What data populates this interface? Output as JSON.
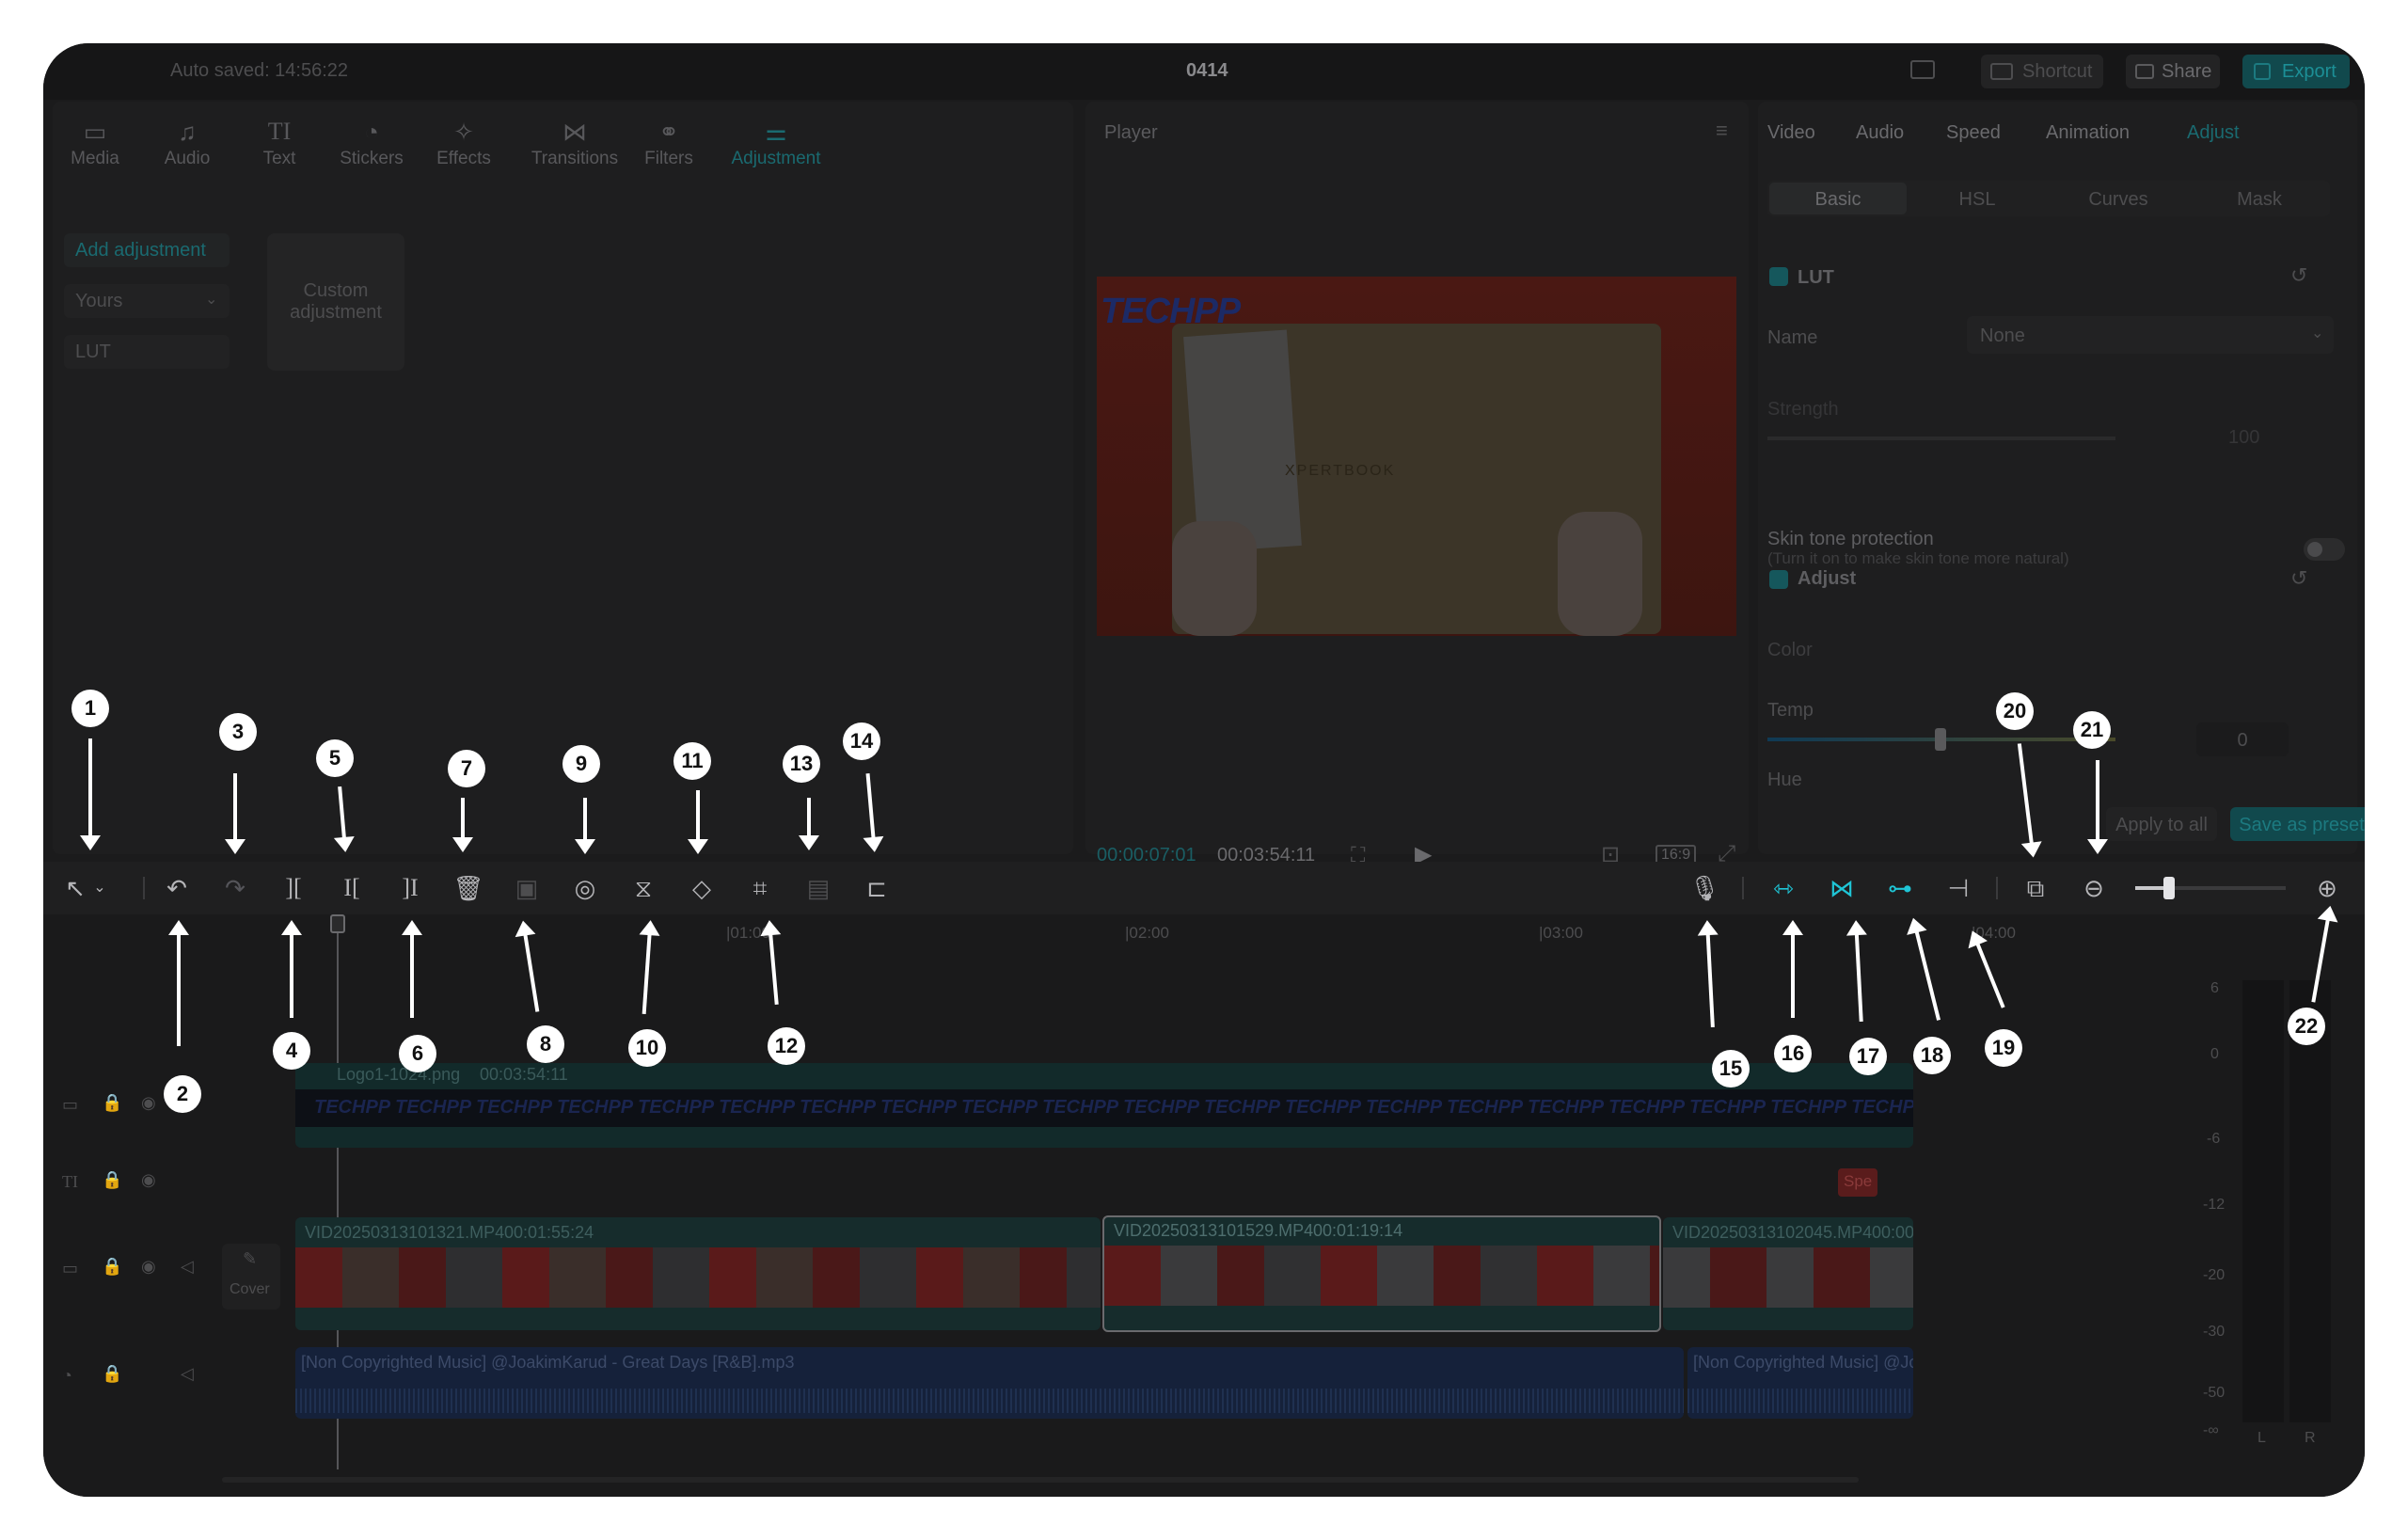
{
  "titlebar": {
    "autosave": "Auto saved: 14:56:22",
    "project": "0414",
    "shortcut": "Shortcut",
    "share": "Share",
    "export": "Export"
  },
  "left": {
    "tabs": [
      {
        "label": "Media",
        "icon": "media-icon"
      },
      {
        "label": "Audio",
        "icon": "audio-icon"
      },
      {
        "label": "Text",
        "icon": "text-icon"
      },
      {
        "label": "Stickers",
        "icon": "stickers-icon"
      },
      {
        "label": "Effects",
        "icon": "effects-icon"
      },
      {
        "label": "Transitions",
        "icon": "transitions-icon"
      },
      {
        "label": "Filters",
        "icon": "filters-icon"
      },
      {
        "label": "Adjustment",
        "icon": "adjustment-icon"
      }
    ],
    "sidebar": [
      "Add adjustment",
      "Yours",
      "LUT"
    ],
    "card": "Custom adjustment"
  },
  "player": {
    "title": "Player",
    "logo": "TECHPP",
    "book_text": "XPERTBOOK",
    "time_current": "00:00:07:01",
    "time_total": "00:03:54:11",
    "ratio": "16:9"
  },
  "right": {
    "tabs": [
      "Video",
      "Audio",
      "Speed",
      "Animation",
      "Adjust"
    ],
    "subtabs": [
      "Basic",
      "HSL",
      "Curves",
      "Mask"
    ],
    "lut_section": "LUT",
    "name_label": "Name",
    "name_value": "None",
    "strength_label": "Strength",
    "strength_value": "100",
    "skin_label": "Skin tone protection",
    "skin_hint": "(Turn it on to make skin tone more natural)",
    "adjust_section": "Adjust",
    "color_label": "Color",
    "temp_label": "Temp",
    "temp_value": "0",
    "hue_label": "Hue",
    "apply_all": "Apply to all",
    "save_preset": "Save as preset"
  },
  "timeline": {
    "ruler": [
      "|01:00",
      "|02:00",
      "|03:00",
      "|04:00"
    ],
    "logo_clip": {
      "name": "Logo1-1024.png",
      "duration": "00:03:54:11",
      "repeat_text": "TECHPP"
    },
    "text_clip": "Spe",
    "video_clips": [
      {
        "name": "VID20250313101321.MP4",
        "duration": "00:01:55:24"
      },
      {
        "name": "VID20250313101529.MP4",
        "duration": "00:01:19:14"
      },
      {
        "name": "VID20250313102045.MP4",
        "duration": "00:00"
      }
    ],
    "cover_label": "Cover",
    "audio_clips": [
      "[Non Copyrighted Music] @JoakimKarud - Great Days [R&B].mp3",
      "[Non Copyrighted Music] @Jo"
    ],
    "meter_scale": [
      "6",
      "0",
      "-6",
      "-12",
      "-20",
      "-30",
      "-50",
      "-∞"
    ],
    "meter_channels": [
      "L",
      "R"
    ]
  },
  "callouts": [
    "1",
    "2",
    "3",
    "4",
    "5",
    "6",
    "7",
    "8",
    "9",
    "10",
    "11",
    "12",
    "13",
    "14",
    "15",
    "16",
    "17",
    "18",
    "19",
    "20",
    "21",
    "22"
  ],
  "colors": {
    "accent": "#1fc5d6",
    "frame": "#1b1b1c",
    "clip_teal": "#173b3b",
    "audio_blue": "#1a2b4a",
    "video_red": "#8a2222"
  }
}
